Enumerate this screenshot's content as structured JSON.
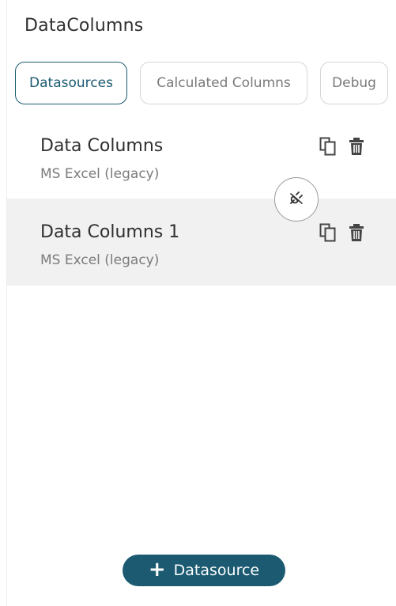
{
  "panel": {
    "title": "DataColumns"
  },
  "tabs": [
    {
      "label": "Datasources",
      "active": true
    },
    {
      "label": "Calculated Columns",
      "active": false
    },
    {
      "label": "Debug",
      "active": false
    }
  ],
  "datasources": [
    {
      "name": "Data Columns",
      "type": "MS Excel (legacy)"
    },
    {
      "name": "Data Columns 1",
      "type": "MS Excel (legacy)"
    }
  ],
  "icons": {
    "copy": "copy-icon",
    "delete": "trash-icon",
    "connect": "plug-icon",
    "add": "plus-icon"
  },
  "footer": {
    "add_label": "Datasource"
  },
  "colors": {
    "accent": "#1b5a71",
    "selected_row": "#f1f1f1"
  }
}
